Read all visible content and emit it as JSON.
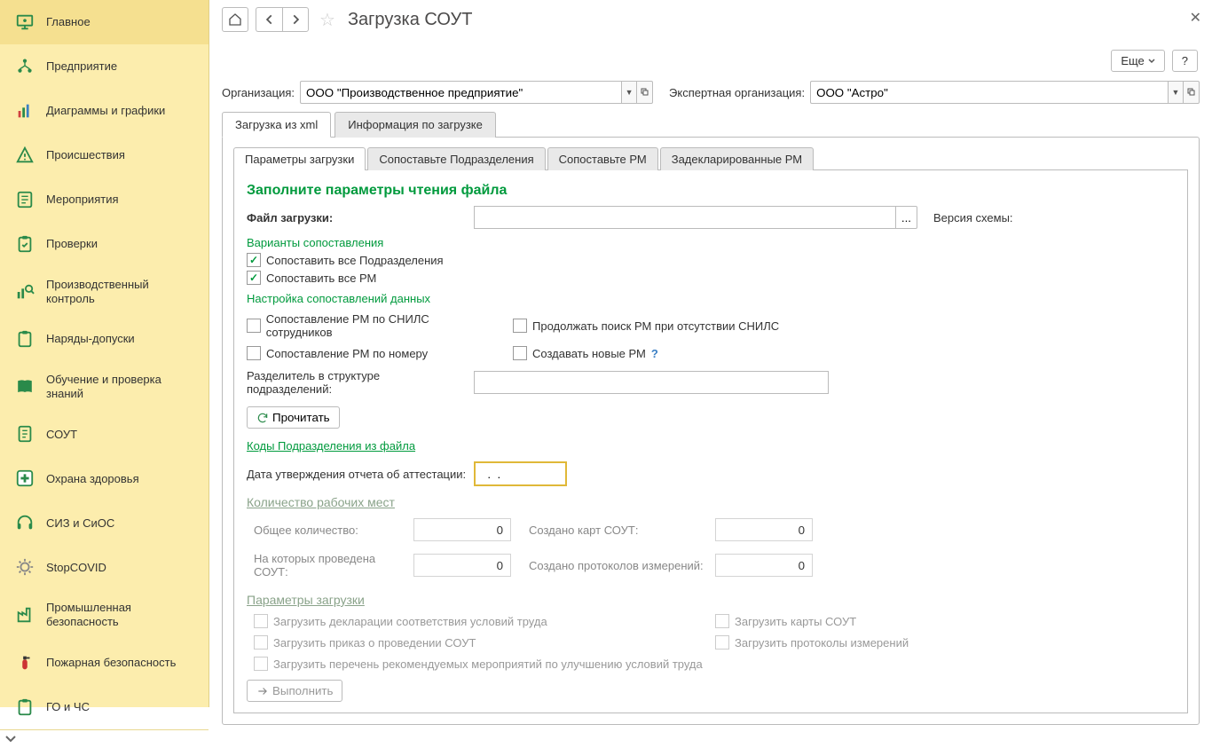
{
  "pageTitle": "Загрузка СОУТ",
  "sidebar": {
    "items": [
      {
        "label": "Главное"
      },
      {
        "label": "Предприятие"
      },
      {
        "label": "Диаграммы и графики"
      },
      {
        "label": "Происшествия"
      },
      {
        "label": "Мероприятия"
      },
      {
        "label": "Проверки"
      },
      {
        "label": "Производственный контроль"
      },
      {
        "label": "Наряды-допуски"
      },
      {
        "label": "Обучение и проверка знаний"
      },
      {
        "label": "СОУТ"
      },
      {
        "label": "Охрана здоровья"
      },
      {
        "label": "СИЗ и СиОС"
      },
      {
        "label": "StopCOVID"
      },
      {
        "label": "Промышленная безопасность"
      },
      {
        "label": "Пожарная безопасность"
      },
      {
        "label": "ГО и ЧС"
      }
    ]
  },
  "topButtons": {
    "more": "Еще",
    "help": "?"
  },
  "org": {
    "label": "Организация:",
    "value": "ООО \"Производственное предприятие\"",
    "expertLabel": "Экспертная организация:",
    "expertValue": "ООО \"Астро\""
  },
  "outerTabs": {
    "xml": "Загрузка из xml",
    "info": "Информация по загрузке"
  },
  "innerTabs": {
    "params": "Параметры загрузки",
    "deps": "Сопоставьте Подразделения",
    "rm": "Сопоставьте РМ",
    "decl": "Задекларированные РМ"
  },
  "sections": {
    "fillParams": "Заполните параметры чтения файла",
    "fileLabel": "Файл загрузки:",
    "browseBtn": "...",
    "schemaLabel": "Версия схемы:",
    "matchVariants": "Варианты сопоставления",
    "matchAllDeps": "Сопоставить все Подразделения",
    "matchAllRM": "Сопоставить все РМ",
    "dataSettings": "Настройка сопоставлений данных",
    "matchSnils": "Сопоставление РМ по СНИЛС сотрудников",
    "continueSearch": "Продолжать поиск РМ при отсутствии СНИЛС",
    "matchByNumber": "Сопоставление РМ по номеру",
    "createNew": "Создавать новые РМ",
    "divider": "Разделитель в структуре подразделений:",
    "readBtn": "Прочитать",
    "codesLink": "Коды Подразделения из файла",
    "approvalDate": "Дата утверждения отчета об аттестации:",
    "dateVal": "  .  .",
    "countTitle": "Количество рабочих мест",
    "totalLabel": "Общее количество:",
    "totalVal": "0",
    "cardsLabel": "Создано карт СОУТ:",
    "cardsVal": "0",
    "soutLabel": "На которых проведена СОУТ:",
    "soutVal": "0",
    "protoLabel": "Создано протоколов измерений:",
    "protoVal": "0",
    "paramsTitle": "Параметры загрузки",
    "loadDecl": "Загрузить декларации соответствия условий труда",
    "loadCards": "Загрузить карты СОУТ",
    "loadOrder": "Загрузить приказ о проведении СОУТ",
    "loadProto": "Загрузить протоколы измерений",
    "loadRecom": "Загрузить перечень рекомендуемых мероприятий по улучшению условий труда",
    "execBtn": "Выполнить"
  }
}
